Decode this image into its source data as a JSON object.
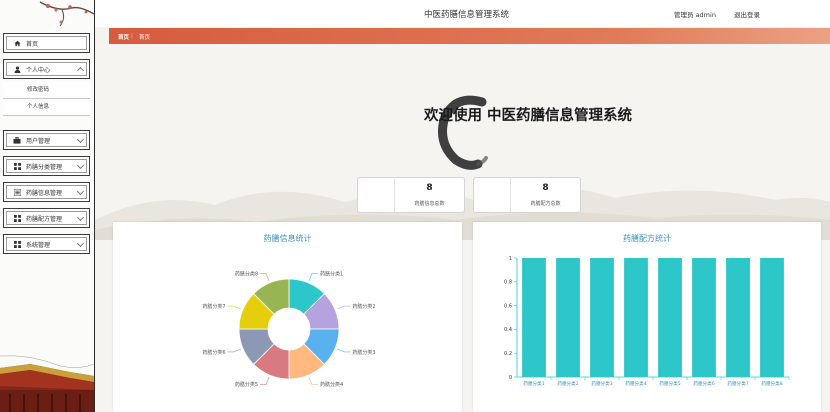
{
  "header": {
    "title": "中医药膳信息管理系统",
    "user": "管理员 admin",
    "logout": "退出登录"
  },
  "breadcrumb": [
    "首页",
    "首页"
  ],
  "sidebar": {
    "items": [
      {
        "label": "首页",
        "icon": "home-icon"
      },
      {
        "label": "个人中心",
        "icon": "user-icon",
        "expanded": true,
        "children": [
          "修改密码",
          "个人信息"
        ]
      },
      {
        "label": "用户管理",
        "icon": "briefcase-icon"
      },
      {
        "label": "药膳分类管理",
        "icon": "grid-icon"
      },
      {
        "label": "药膳信息管理",
        "icon": "list-icon"
      },
      {
        "label": "药膳配方管理",
        "icon": "grid-icon"
      },
      {
        "label": "系统管理",
        "icon": "grid-icon"
      }
    ]
  },
  "welcome": "欢迎使用 中医药膳信息管理系统",
  "stats": [
    {
      "value": "8",
      "label": "药膳信息总数"
    },
    {
      "value": "8",
      "label": "药膳配方总数"
    }
  ],
  "colors": {
    "accent": "#d75b3e",
    "chart_title": "#3f8fb5",
    "bar": "#2ec7c9"
  },
  "chart_data": [
    {
      "type": "pie",
      "title": "药膳信息统计",
      "donut": true,
      "categories": [
        "药膳分类1",
        "药膳分类2",
        "药膳分类3",
        "药膳分类4",
        "药膳分类5",
        "药膳分类6",
        "药膳分类7",
        "药膳分类8"
      ],
      "values": [
        1,
        1,
        1,
        1,
        1,
        1,
        1,
        1
      ],
      "colors": [
        "#2ec7c9",
        "#b6a2de",
        "#5ab1ef",
        "#ffb980",
        "#d87a80",
        "#8d98b3",
        "#e5cf0d",
        "#97b552"
      ]
    },
    {
      "type": "bar",
      "title": "药膳配方统计",
      "categories": [
        "药膳分类1",
        "药膳分类2",
        "药膳分类3",
        "药膳分类4",
        "药膳分类5",
        "药膳分类6",
        "药膳分类7",
        "药膳分类8"
      ],
      "values": [
        1,
        1,
        1,
        1,
        1,
        1,
        1,
        1
      ],
      "yticks": [
        "0",
        "0.2",
        "0.4",
        "0.6",
        "0.8",
        "1"
      ],
      "ylim": [
        0,
        1
      ],
      "color": "#2ec7c9"
    }
  ]
}
